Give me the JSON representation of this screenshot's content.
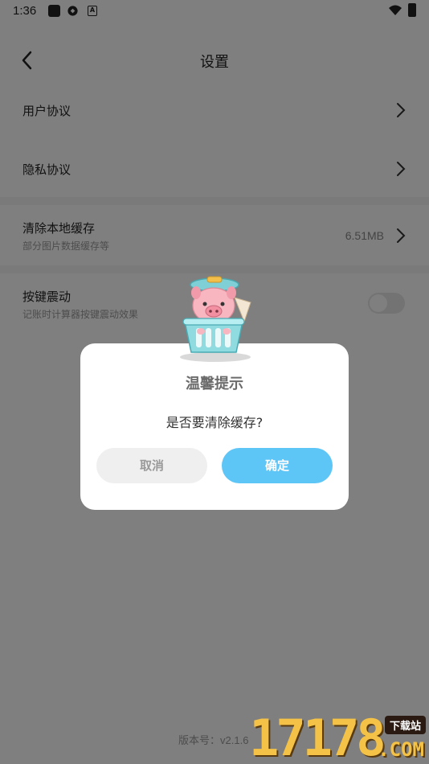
{
  "status_bar": {
    "time": "1:36",
    "notif_icon_letter": "A"
  },
  "header": {
    "title": "设置"
  },
  "settings": {
    "user_agreement": "用户协议",
    "privacy_agreement": "隐私协议",
    "clear_cache": {
      "label": "清除本地缓存",
      "subtitle": "部分图片数据缓存等",
      "value": "6.51MB"
    },
    "key_vibration": {
      "label": "按键震动",
      "subtitle": "记账时计算器按键震动效果",
      "enabled": false
    }
  },
  "version": {
    "label": "版本号：",
    "number": "v2.1.6"
  },
  "dialog": {
    "title": "温馨提示",
    "message": "是否要清除缓存?",
    "cancel_label": "取消",
    "confirm_label": "确定"
  },
  "watermark": {
    "number": "17178",
    "badge": "下载站",
    "domain": ".COM"
  },
  "colors": {
    "accent": "#5ec5f7",
    "dialog_title": "#6b6b6b",
    "watermark": "#f3c246"
  }
}
